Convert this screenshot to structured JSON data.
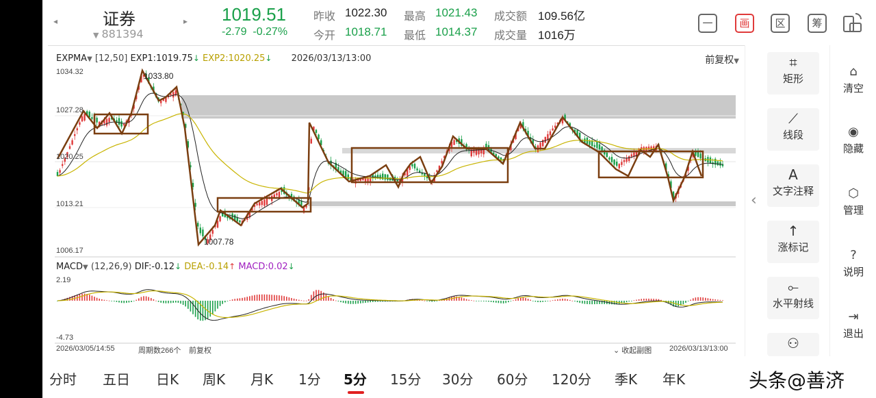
{
  "header": {
    "stock_name": "证券",
    "stock_code": "881394",
    "price": "1019.51",
    "change": "-2.79",
    "change_pct": "-0.27%",
    "stats": {
      "prev_close_label": "昨收",
      "prev_close": "1022.30",
      "high_label": "最高",
      "high": "1021.43",
      "turnover_label": "成交额",
      "turnover": "109.56亿",
      "open_label": "今开",
      "open": "1018.71",
      "low_label": "最低",
      "low": "1014.37",
      "volume_label": "成交量",
      "volume": "1016万"
    },
    "buttons": {
      "minus": "一",
      "draw": "画",
      "zone": "区",
      "chips": "筹"
    }
  },
  "main_chart": {
    "indicator": "EXPMA",
    "params": "[12,50]",
    "exp1": "EXP1:1019.75",
    "exp2": "EXP2:1020.25",
    "datetime": "2026/03/13/13:00",
    "adjust": "前复权",
    "y_labels": [
      "1034.32",
      "1027.28",
      "1020.25",
      "1013.21",
      "1006.17"
    ],
    "high_mark": "1033.80",
    "low_mark": "1007.78"
  },
  "sub_chart": {
    "indicator": "MACD",
    "params": "(12,26,9)",
    "dif": "DIF:-0.12",
    "dea": "DEA:-0.14",
    "macd": "MACD:0.02",
    "y_top": "2.19",
    "y_bottom": "-4.73",
    "start_date": "2026/03/05/14:55",
    "period_count": "周期数266个",
    "adjust": "前复权",
    "collapse": "收起副图",
    "end_date": "2026/03/13/13:00"
  },
  "tools": [
    {
      "icon": "rectangle-icon",
      "label": "矩形",
      "glyph": "⌗"
    },
    {
      "icon": "line-segment-icon",
      "label": "线段",
      "glyph": "⟋"
    },
    {
      "icon": "text-annotation-icon",
      "label": "文字注释",
      "glyph": "A"
    },
    {
      "icon": "rise-mark-icon",
      "label": "涨标记",
      "glyph": "↑"
    },
    {
      "icon": "horizontal-ray-icon",
      "label": "水平射线",
      "glyph": "⟜"
    }
  ],
  "side": [
    {
      "icon": "clear-icon",
      "label": "清空",
      "glyph": "⌂"
    },
    {
      "icon": "hide-icon",
      "label": "隐藏",
      "glyph": "◉"
    },
    {
      "icon": "manage-icon",
      "label": "管理",
      "glyph": "⬡"
    },
    {
      "icon": "help-icon",
      "label": "说明",
      "glyph": "?"
    },
    {
      "icon": "exit-icon",
      "label": "退出",
      "glyph": "⇥"
    }
  ],
  "periods": [
    "分时",
    "五日",
    "日K",
    "周K",
    "月K",
    "1分",
    "5分",
    "15分",
    "30分",
    "60分",
    "120分",
    "季K",
    "年K"
  ],
  "active_period": "5分",
  "watermark": "头条@善济",
  "colors": {
    "down": "#1aa04a",
    "up": "#e03a3a",
    "exp1": "#222222",
    "exp2": "#c8b400",
    "box": "#7a3e10"
  }
}
